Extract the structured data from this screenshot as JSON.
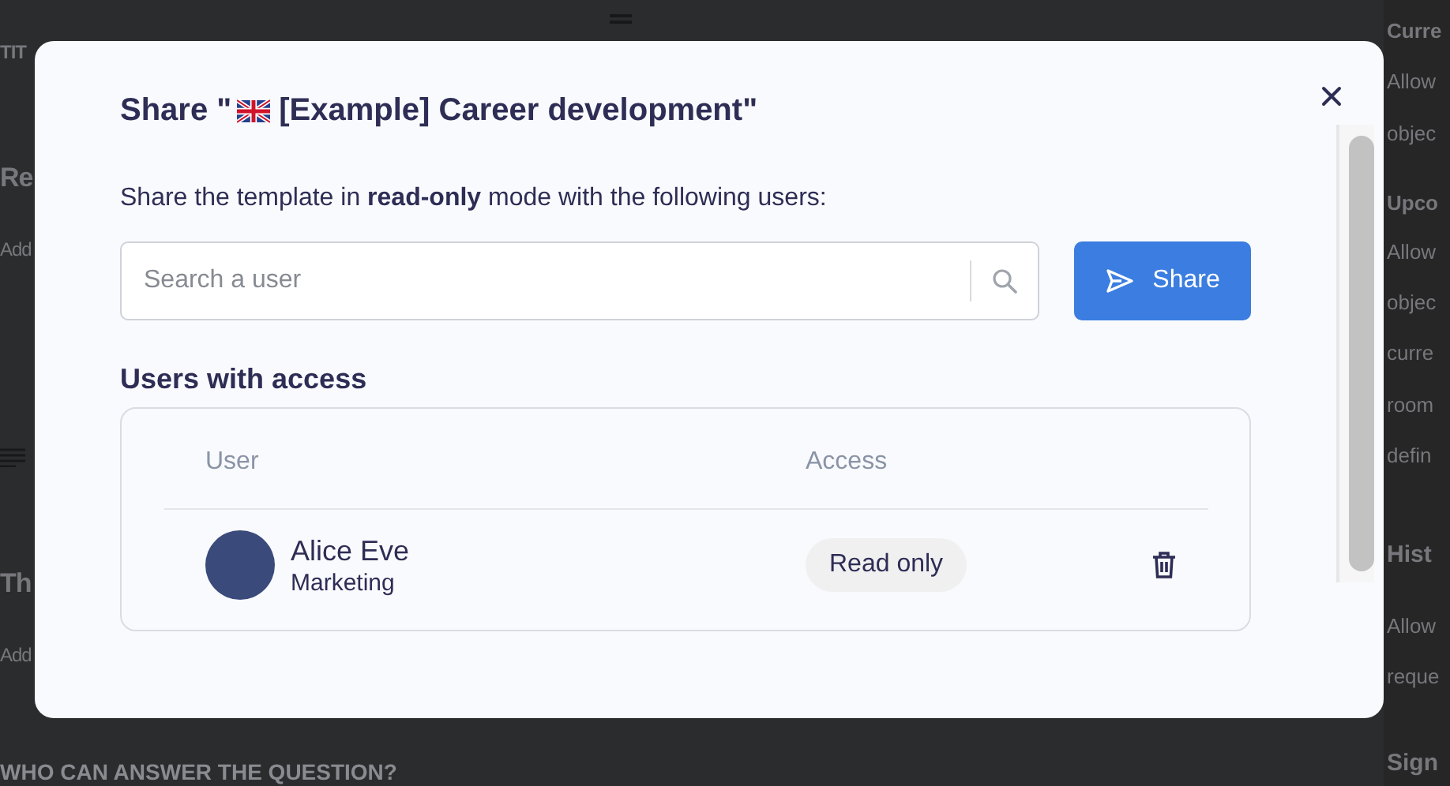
{
  "background": {
    "left_items": [
      {
        "kind": "caps",
        "text": "TIT"
      },
      {
        "kind": "heading",
        "text": "Re"
      },
      {
        "kind": "body",
        "text": "Add"
      },
      {
        "kind": "icon"
      },
      {
        "kind": "heading",
        "text": "Th"
      },
      {
        "kind": "body",
        "text": "Add"
      }
    ],
    "footer": "WHO CAN ANSWER THE QUESTION?",
    "right_items": [
      {
        "kind": "label",
        "text": "Curre"
      },
      {
        "kind": "body",
        "text": "Allow"
      },
      {
        "kind": "body",
        "text": "objec"
      },
      {
        "kind": "label",
        "text": "Upco"
      },
      {
        "kind": "body",
        "text": "Allow"
      },
      {
        "kind": "body",
        "text": "objec"
      },
      {
        "kind": "body",
        "text": "curre"
      },
      {
        "kind": "body",
        "text": "room"
      },
      {
        "kind": "body",
        "text": "defin"
      },
      {
        "kind": "heading",
        "text": "Hist"
      },
      {
        "kind": "body",
        "text": "Allow"
      },
      {
        "kind": "body",
        "text": "reque"
      },
      {
        "kind": "heading",
        "text": "Sign"
      }
    ]
  },
  "dialog": {
    "title_before": "Share \"",
    "title_after": "[Example] Career development\"",
    "description": "Share the template in **read-only** mode with the following users:",
    "search": {
      "placeholder": "Search a user"
    },
    "share_button": "Share",
    "section_title": "Users with access",
    "table": {
      "columns": [
        "User",
        "Access"
      ],
      "rows": [
        {
          "name": "Alice Eve",
          "team": "Marketing",
          "access": "Read only"
        }
      ]
    }
  }
}
